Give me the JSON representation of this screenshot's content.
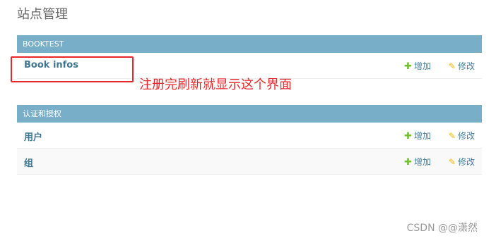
{
  "page": {
    "title": "站点管理"
  },
  "modules": [
    {
      "header": "BOOKTEST",
      "rows": [
        {
          "label": "Book infos",
          "add_label": "增加",
          "change_label": "修改"
        }
      ]
    },
    {
      "header": "认证和授权",
      "rows": [
        {
          "label": "用户",
          "add_label": "增加",
          "change_label": "修改"
        },
        {
          "label": "组",
          "add_label": "增加",
          "change_label": "修改"
        }
      ]
    }
  ],
  "annotation": {
    "text": "注册完刷新就显示这个界面",
    "color": "#e8272b"
  },
  "watermark": "CSDN @@潇然",
  "icons": {
    "add": "plus-icon",
    "change": "pencil-icon"
  },
  "colors": {
    "module_header": "#79aec8",
    "link": "#417690",
    "add_icon": "#70bf2b",
    "change_icon": "#efb80b"
  }
}
